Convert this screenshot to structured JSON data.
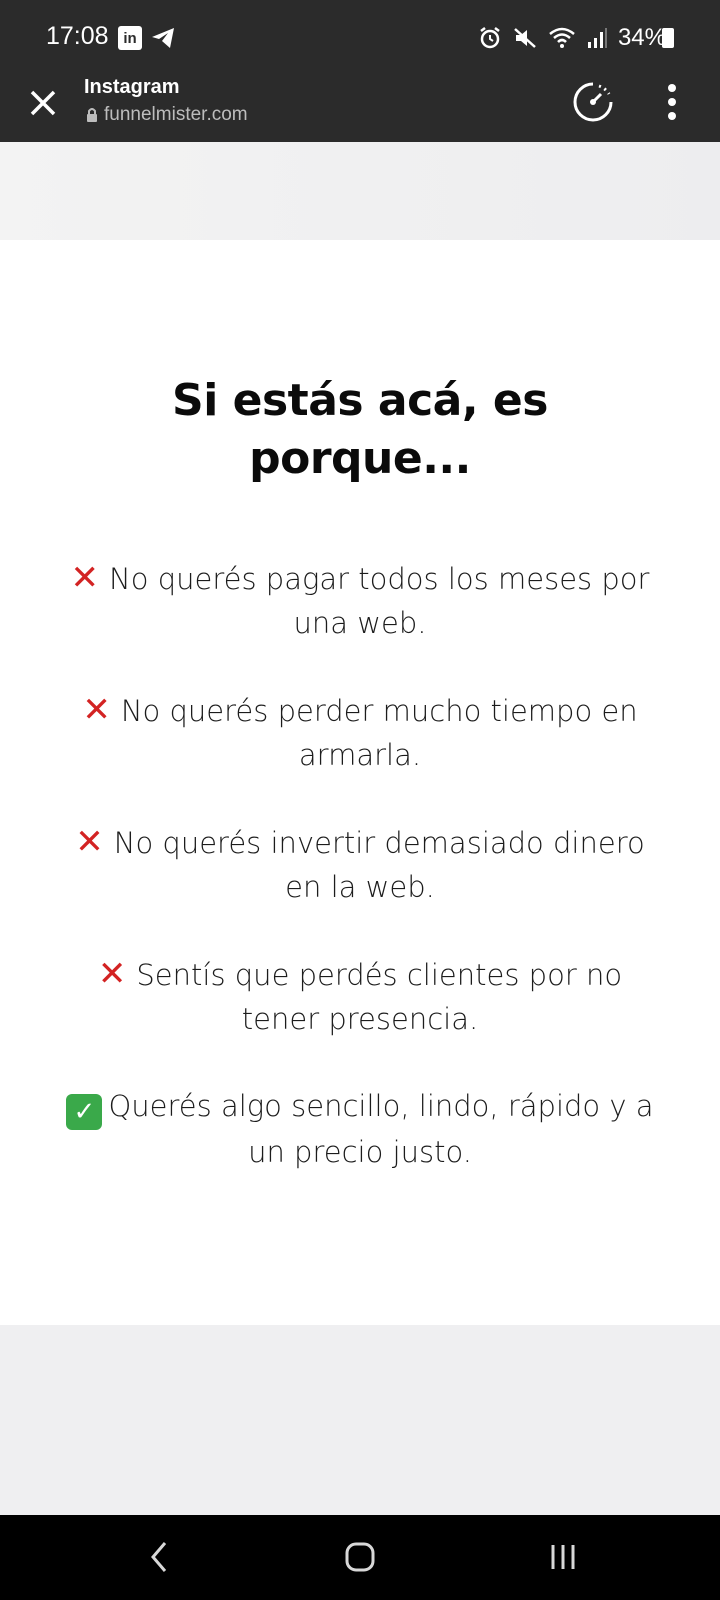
{
  "status_bar": {
    "time": "17:08",
    "battery": "34%",
    "icons": [
      "linkedin-icon",
      "telegram-icon",
      "alarm-icon",
      "mute-icon",
      "wifi-icon",
      "signal-icon",
      "battery-icon"
    ]
  },
  "browser": {
    "title": "Instagram",
    "url": "funnelmister.com",
    "icons": [
      "close-icon",
      "lock-icon",
      "speed-icon",
      "more-vert-icon"
    ]
  },
  "content": {
    "heading": "Si estás acá, es porque...",
    "items": [
      {
        "icon": "cross-mark-icon",
        "mark": "✕",
        "text": "No querés pagar todos los meses por una web."
      },
      {
        "icon": "cross-mark-icon",
        "mark": "✕",
        "text": "No querés perder mucho tiempo en armarla."
      },
      {
        "icon": "cross-mark-icon",
        "mark": "✕",
        "text": "No querés invertir demasiado dinero en la web."
      },
      {
        "icon": "cross-mark-icon",
        "mark": "✕",
        "text": "Sentís que perdés clientes por no tener presencia."
      },
      {
        "icon": "check-mark-icon",
        "mark": "✓",
        "text": "Querés algo sencillo, lindo, rápido y a un precio justo."
      }
    ]
  },
  "nav": {
    "icons": [
      "back-icon",
      "home-icon",
      "recents-icon"
    ]
  },
  "colors": {
    "status_bg": "#2b2b2b",
    "cross_red": "#d32323",
    "check_green": "#3aa94a",
    "page_gray": "#efeff1"
  }
}
